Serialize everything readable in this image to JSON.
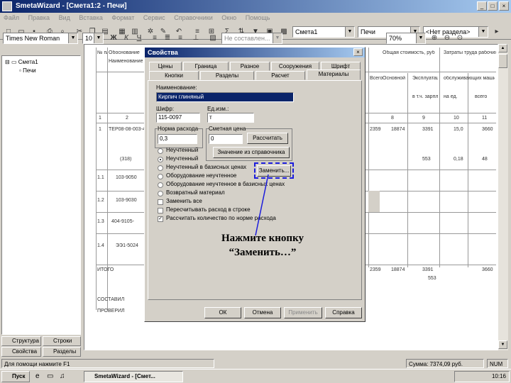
{
  "window": {
    "title": "SmetaWizard - [Смета1:2 - Печи]",
    "min": "_",
    "max": "□",
    "close": "×"
  },
  "menu": [
    "Файл",
    "Правка",
    "Вид",
    "Вставка",
    "Формат",
    "Сервис",
    "Справочники",
    "Окно",
    "Помощь"
  ],
  "toolbar1": {
    "smeta_combo": "Смета1",
    "section_combo": "Печи",
    "division_combo": "<Нет раздела>"
  },
  "toolbar2": {
    "font": "Times New Roman",
    "size": "10",
    "bold": "Ж",
    "italic": "К",
    "underline": "Ч",
    "style_combo": "Не составлен...",
    "zoom": "70%"
  },
  "tree": {
    "root": "Смета1",
    "child": "Печи"
  },
  "doc": {
    "headers": [
      "№ п/п",
      "Обоснование",
      "Наименование",
      "Общая стоимость, руб",
      "Затраты труда рабочих",
      "Всего",
      "Основной зарплаты",
      "Эксплуатации машин",
      "обслуживающих машины",
      "в т.ч. зарплаты",
      "на ед.",
      "всего"
    ],
    "col_numbers": [
      "1",
      "2",
      "8",
      "9",
      "10",
      "11"
    ],
    "rows": [
      {
        "num": "1",
        "code": "ТЕР08-08-003-4",
        "v1": "2359",
        "v2": "18874",
        "v3": "3391",
        "v4": "15,0",
        "v5": "3660"
      },
      {
        "num": "",
        "code": "(318)",
        "v1": "",
        "v2": "",
        "v3": "553",
        "v4": "0,18",
        "v5": "48"
      },
      {
        "num": "1.1",
        "code": "103-9050",
        "v1": "",
        "v2": "",
        "v3": "",
        "v4": "",
        "v5": ""
      },
      {
        "num": "1.2",
        "code": "103-9030",
        "v1": "",
        "v2": "",
        "v3": "",
        "v4": "",
        "v5": ""
      },
      {
        "num": "1.3",
        "code": "404-9105-",
        "v1": "",
        "v2": "",
        "v3": "",
        "v4": "",
        "v5": ""
      },
      {
        "num": "1.4",
        "code": "ЭЭ1-5024",
        "v1": "",
        "v2": "",
        "v3": "",
        "v4": "",
        "v5": ""
      }
    ],
    "total_label": "ИТОГО",
    "total": {
      "v1": "2359",
      "v2": "18874",
      "v3": "3391",
      "v5": "3660",
      "v6": "553"
    },
    "composed": "СОСТАВИЛ",
    "checked": "ПРОВЕРИЛ"
  },
  "bottom_tabs": [
    "Структура",
    "Строки",
    "Свойства",
    "Разделы"
  ],
  "status": {
    "left": "Для помощи нажмите F1",
    "mid": "Сумма: 7374,09 руб.",
    "right": "NUM"
  },
  "taskbar": {
    "start": "Пуск",
    "task": "SmetaWizard - [Смет...",
    "time": "10:16"
  },
  "dialog": {
    "title": "Свойства",
    "tabs_row1": [
      "Цены",
      "Граница",
      "Разное",
      "Сооружения",
      "Шрифт"
    ],
    "tabs_row2": [
      "Кнопки",
      "Разделы",
      "Расчет",
      "Материалы"
    ],
    "name_label": "Наименование:",
    "name_value": "Кирпич глиняный",
    "code_label": "Шифр:",
    "code_value": "115-0097",
    "unit_label": "Ед.изм.:",
    "unit_value": "т",
    "norm_label": "Норма расхода",
    "norm_value": "0,3",
    "price_label": "Сметная цена",
    "price_value": "0",
    "calc_btn": "Рассчитать",
    "ref_btn": "Значение из справочника",
    "replace_btn": "Заменить...",
    "options": [
      "Неучтенный",
      "Неучтенный",
      "Неучтенный в базисных ценах",
      "Оборудование неучтенное",
      "Оборудование неучтенное в базисных ценах",
      "Возвратный материал"
    ],
    "checks": [
      "Заменить все",
      "Пересчитывать расход в строке",
      "Рассчитать количество по норме расхода"
    ],
    "ok": "ОК",
    "cancel": "Отмена",
    "apply": "Применить",
    "help": "Справка"
  },
  "callout": {
    "line1": "Нажмите кнопку",
    "line2": "“Заменить…”"
  },
  "colors": {
    "accent": "#0a246a",
    "callout_arrow": "#1c1cdc"
  }
}
